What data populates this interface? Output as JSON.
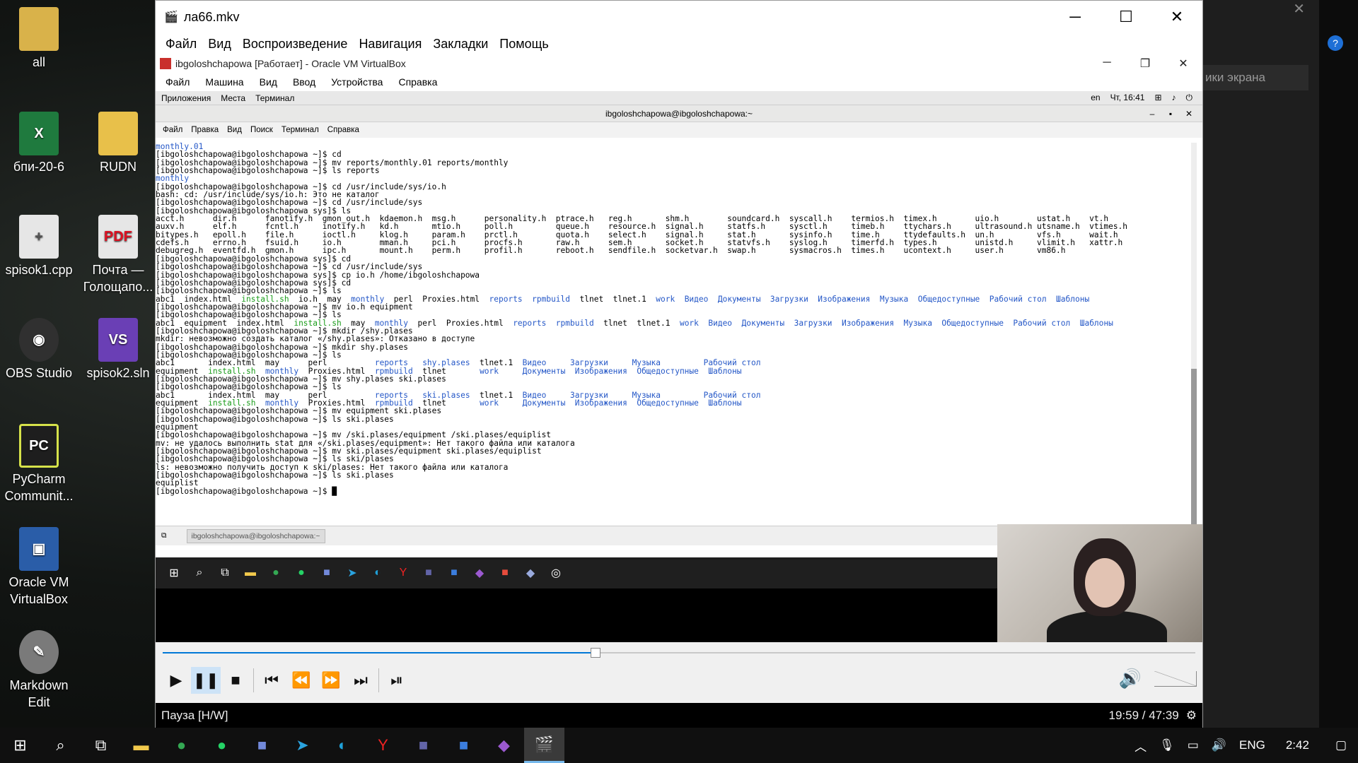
{
  "desktop": {
    "icons": [
      {
        "label": "all",
        "color": "#d9b24a"
      },
      {
        "label": "бпи-20-6",
        "color": "#1f7a3e"
      },
      {
        "label": "RUDN",
        "color": "#e8c04a"
      },
      {
        "label": "spisok1.cpp",
        "color": "#e6e6e6"
      },
      {
        "label": "Почта — Голощапо...",
        "color": "#e6e6e6"
      },
      {
        "label": "OBS Studio",
        "color": "#303030"
      },
      {
        "label": "spisok2.sln",
        "color": "#6a3fb5"
      },
      {
        "label": "PyCharm Communit...",
        "color": "#1e1e1e"
      },
      {
        "label": "Oracle VM VirtualBox",
        "color": "#2a5da8"
      },
      {
        "label": "Markdown Edit",
        "color": "#7a7a7a"
      }
    ]
  },
  "player": {
    "title": "ла66.mkv",
    "menu": [
      "Файл",
      "Вид",
      "Воспроизведение",
      "Навигация",
      "Закладки",
      "Помощь"
    ],
    "status": "Пауза [H/W]",
    "time": "19:59 / 47:39",
    "progress": 0.419
  },
  "vbox": {
    "title": "ibgoloshchapowa [Работает] - Oracle VM VirtualBox",
    "menu": [
      "Файл",
      "Машина",
      "Вид",
      "Ввод",
      "Устройства",
      "Справка"
    ]
  },
  "guest": {
    "panel": [
      "Приложения",
      "Места",
      "Терминал"
    ],
    "lang": "en",
    "clock": "Чт, 16:41",
    "term_title": "ibgoloshchapowa@ibgoloshchapowa:~",
    "term_menu": [
      "Файл",
      "Правка",
      "Вид",
      "Поиск",
      "Терминал",
      "Справка"
    ],
    "bottom_tab": "ibgoloshchapowa@ibgoloshchapowa:~"
  },
  "terminal_lines": [
    [
      [
        "b",
        "monthly.01"
      ]
    ],
    [
      [
        "n",
        "[ibgoloshchapowa@ibgoloshchapowa ~]$ cd"
      ]
    ],
    [
      [
        "n",
        "[ibgoloshchapowa@ibgoloshchapowa ~]$ mv reports/monthly.01 reports/monthly"
      ]
    ],
    [
      [
        "n",
        "[ibgoloshchapowa@ibgoloshchapowa ~]$ ls reports"
      ]
    ],
    [
      [
        "b",
        "monthly"
      ]
    ],
    [
      [
        "n",
        "[ibgoloshchapowa@ibgoloshchapowa ~]$ cd /usr/include/sys/io.h"
      ]
    ],
    [
      [
        "n",
        "bash: cd: /usr/include/sys/io.h: Это не каталог"
      ]
    ],
    [
      [
        "n",
        "[ibgoloshchapowa@ibgoloshchapowa ~]$ cd /usr/include/sys"
      ]
    ],
    [
      [
        "n",
        "[ibgoloshchapowa@ibgoloshchapowa sys]$ ls"
      ]
    ],
    [
      [
        "n",
        "acct.h      dir.h      fanotify.h  gmon_out.h  kdaemon.h  msg.h      personality.h  ptrace.h   reg.h       shm.h        soundcard.h  syscall.h    termios.h  timex.h        uio.h        ustat.h    vt.h"
      ]
    ],
    [
      [
        "n",
        "auxv.h      elf.h      fcntl.h     inotify.h   kd.h       mtio.h     poll.h         queue.h    resource.h  signal.h     statfs.h     sysctl.h     timeb.h    ttychars.h     ultrasound.h utsname.h  vtimes.h"
      ]
    ],
    [
      [
        "n",
        "bitypes.h   epoll.h    file.h      ioctl.h     klog.h     param.h    prctl.h        quota.h    select.h    signal.h     stat.h       sysinfo.h    time.h     ttydefaults.h  un.h         vfs.h      wait.h"
      ]
    ],
    [
      [
        "n",
        "cdefs.h     errno.h    fsuid.h     io.h        mman.h     pci.h      procfs.h       raw.h      sem.h       socket.h     statvfs.h    syslog.h     timerfd.h  types.h        unistd.h     vlimit.h   xattr.h"
      ]
    ],
    [
      [
        "n",
        "debugreg.h  eventfd.h  gmon.h      ipc.h       mount.h    perm.h     profil.h       reboot.h   sendfile.h  socketvar.h  swap.h       sysmacros.h  times.h    ucontext.h     user.h       vm86.h"
      ]
    ],
    [
      [
        "n",
        "[ibgoloshchapowa@ibgoloshchapowa sys]$ cd"
      ]
    ],
    [
      [
        "n",
        "[ibgoloshchapowa@ibgoloshchapowa ~]$ cd /usr/include/sys"
      ]
    ],
    [
      [
        "n",
        "[ibgoloshchapowa@ibgoloshchapowa sys]$ cp io.h /home/ibgoloshchapowa"
      ]
    ],
    [
      [
        "n",
        "[ibgoloshchapowa@ibgoloshchapowa sys]$ cd"
      ]
    ],
    [
      [
        "n",
        "[ibgoloshchapowa@ibgoloshchapowa ~]$ ls"
      ]
    ],
    [
      [
        "n",
        "abc1  index.html  "
      ],
      [
        "g",
        "install.sh"
      ],
      [
        "n",
        "  io.h  may  "
      ],
      [
        "b",
        "monthly"
      ],
      [
        "n",
        "  perl  Proxies.html  "
      ],
      [
        "b",
        "reports  rpmbuild"
      ],
      [
        "n",
        "  tlnet  tlnet.1  "
      ],
      [
        "b",
        "work  Видео  Документы  Загрузки  Изображения  Музыка  Общедоступные  Рабочий стол  Шаблоны"
      ]
    ],
    [
      [
        "n",
        "[ibgoloshchapowa@ibgoloshchapowa ~]$ mv io.h equipment"
      ]
    ],
    [
      [
        "n",
        "[ibgoloshchapowa@ibgoloshchapowa ~]$ ls"
      ]
    ],
    [
      [
        "n",
        "abc1  equipment  index.html  "
      ],
      [
        "g",
        "install.sh"
      ],
      [
        "n",
        "  may  "
      ],
      [
        "b",
        "monthly"
      ],
      [
        "n",
        "  perl  Proxies.html  "
      ],
      [
        "b",
        "reports  rpmbuild"
      ],
      [
        "n",
        "  tlnet  tlnet.1  "
      ],
      [
        "b",
        "work  Видео  Документы  Загрузки  Изображения  Музыка  Общедоступные  Рабочий стол  Шаблоны"
      ]
    ],
    [
      [
        "n",
        "[ibgoloshchapowa@ibgoloshchapowa ~]$ mkdir /shy.plases"
      ]
    ],
    [
      [
        "n",
        "mkdir: невозможно создать каталог «/shy.plases»: Отказано в доступе"
      ]
    ],
    [
      [
        "n",
        "[ibgoloshchapowa@ibgoloshchapowa ~]$ mkdir shy.plases"
      ]
    ],
    [
      [
        "n",
        "[ibgoloshchapowa@ibgoloshchapowa ~]$ ls"
      ]
    ],
    [
      [
        "n",
        "abc1       index.html  may      perl          "
      ],
      [
        "b",
        "reports   shy.plases"
      ],
      [
        "n",
        "  tlnet.1  "
      ],
      [
        "b",
        "Видео     Загрузки     Музыка         Рабочий стол"
      ]
    ],
    [
      [
        "n",
        "equipment  "
      ],
      [
        "g",
        "install.sh"
      ],
      [
        "n",
        "  "
      ],
      [
        "b",
        "monthly"
      ],
      [
        "n",
        "  Proxies.html  "
      ],
      [
        "b",
        "rpmbuild"
      ],
      [
        "n",
        "  tlnet       "
      ],
      [
        "b",
        "work     Документы  Изображения  Общедоступные  Шаблоны"
      ]
    ],
    [
      [
        "n",
        "[ibgoloshchapowa@ibgoloshchapowa ~]$ mv shy.plases ski.plases"
      ]
    ],
    [
      [
        "n",
        "[ibgoloshchapowa@ibgoloshchapowa ~]$ ls"
      ]
    ],
    [
      [
        "n",
        "abc1       index.html  may      perl          "
      ],
      [
        "b",
        "reports   ski.plases"
      ],
      [
        "n",
        "  tlnet.1  "
      ],
      [
        "b",
        "Видео     Загрузки     Музыка         Рабочий стол"
      ]
    ],
    [
      [
        "n",
        "equipment  "
      ],
      [
        "g",
        "install.sh"
      ],
      [
        "n",
        "  "
      ],
      [
        "b",
        "monthly"
      ],
      [
        "n",
        "  Proxies.html  "
      ],
      [
        "b",
        "rpmbuild"
      ],
      [
        "n",
        "  tlnet       "
      ],
      [
        "b",
        "work     Документы  Изображения  Общедоступные  Шаблоны"
      ]
    ],
    [
      [
        "n",
        "[ibgoloshchapowa@ibgoloshchapowa ~]$ mv equipment ski.plases"
      ]
    ],
    [
      [
        "n",
        "[ibgoloshchapowa@ibgoloshchapowa ~]$ ls ski.plases"
      ]
    ],
    [
      [
        "n",
        "equipment"
      ]
    ],
    [
      [
        "n",
        "[ibgoloshchapowa@ibgoloshchapowa ~]$ mv /ski.plases/equipment /ski.plases/equiplist"
      ]
    ],
    [
      [
        "n",
        "mv: не удалось выполнить stat для «/ski.plases/equipment»: Нет такого файла или каталога"
      ]
    ],
    [
      [
        "n",
        "[ibgoloshchapowa@ibgoloshchapowa ~]$ mv ski.plases/equipment ski.plases/equiplist"
      ]
    ],
    [
      [
        "n",
        "[ibgoloshchapowa@ibgoloshchapowa ~]$ ls ski/plases"
      ]
    ],
    [
      [
        "n",
        "ls: невозможно получить доступ к ski/plases: Нет такого файла или каталога"
      ]
    ],
    [
      [
        "n",
        "[ibgoloshchapowa@ibgoloshchapowa ~]$ ls ski.plases"
      ]
    ],
    [
      [
        "n",
        "equiplist"
      ]
    ],
    [
      [
        "n",
        "[ibgoloshchapowa@ibgoloshchapowa ~]$ "
      ]
    ]
  ],
  "right_panel": {
    "hint": "ики экрана"
  },
  "taskbar": {
    "lang": "ENG",
    "clock": "2:42"
  }
}
